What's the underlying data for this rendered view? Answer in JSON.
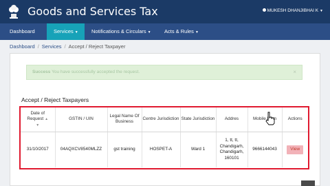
{
  "header": {
    "title": "Goods and Services Tax",
    "user": "MUKESH DHANJIBHAI K"
  },
  "nav": {
    "items": [
      {
        "label": "Dashboard",
        "active": false,
        "dropdown": false
      },
      {
        "label": "Services",
        "active": true,
        "dropdown": true
      },
      {
        "label": "Notifications & Circulars",
        "active": false,
        "dropdown": true
      },
      {
        "label": "Acts & Rules",
        "active": false,
        "dropdown": true
      }
    ]
  },
  "breadcrumb": [
    "Dashboard",
    "Services",
    "Accept / Reject Taxpayer"
  ],
  "alert": {
    "strong": "Success",
    "message": "You have successfully accepted the request.",
    "close": "×"
  },
  "section": {
    "title": "Accept / Reject Taxpayers"
  },
  "table": {
    "headers": [
      "Date of Request",
      "GSTIN / UIN",
      "Legal Name Of Business",
      "Centre Jurisdiction",
      "State Jurisdiction",
      "Addres",
      "Mobile Num",
      "Actions"
    ],
    "rows": [
      {
        "date": "31/10/2017",
        "gstin": "04AQXCV8540MLZZ",
        "legal_name": "gst training",
        "centre": "HOSPET-A",
        "state": "Ward 1",
        "address": "1, tt, tt, Chandigarh, Chandigarh, 160101",
        "mobile": "9666144043",
        "action": "View"
      }
    ]
  },
  "colors": {
    "header_bg": "#1b3a66",
    "nav_bg": "#2c4e86",
    "nav_active": "#17a2b8",
    "highlight_border": "#e0192f",
    "view_button": "#f2b2b8"
  }
}
